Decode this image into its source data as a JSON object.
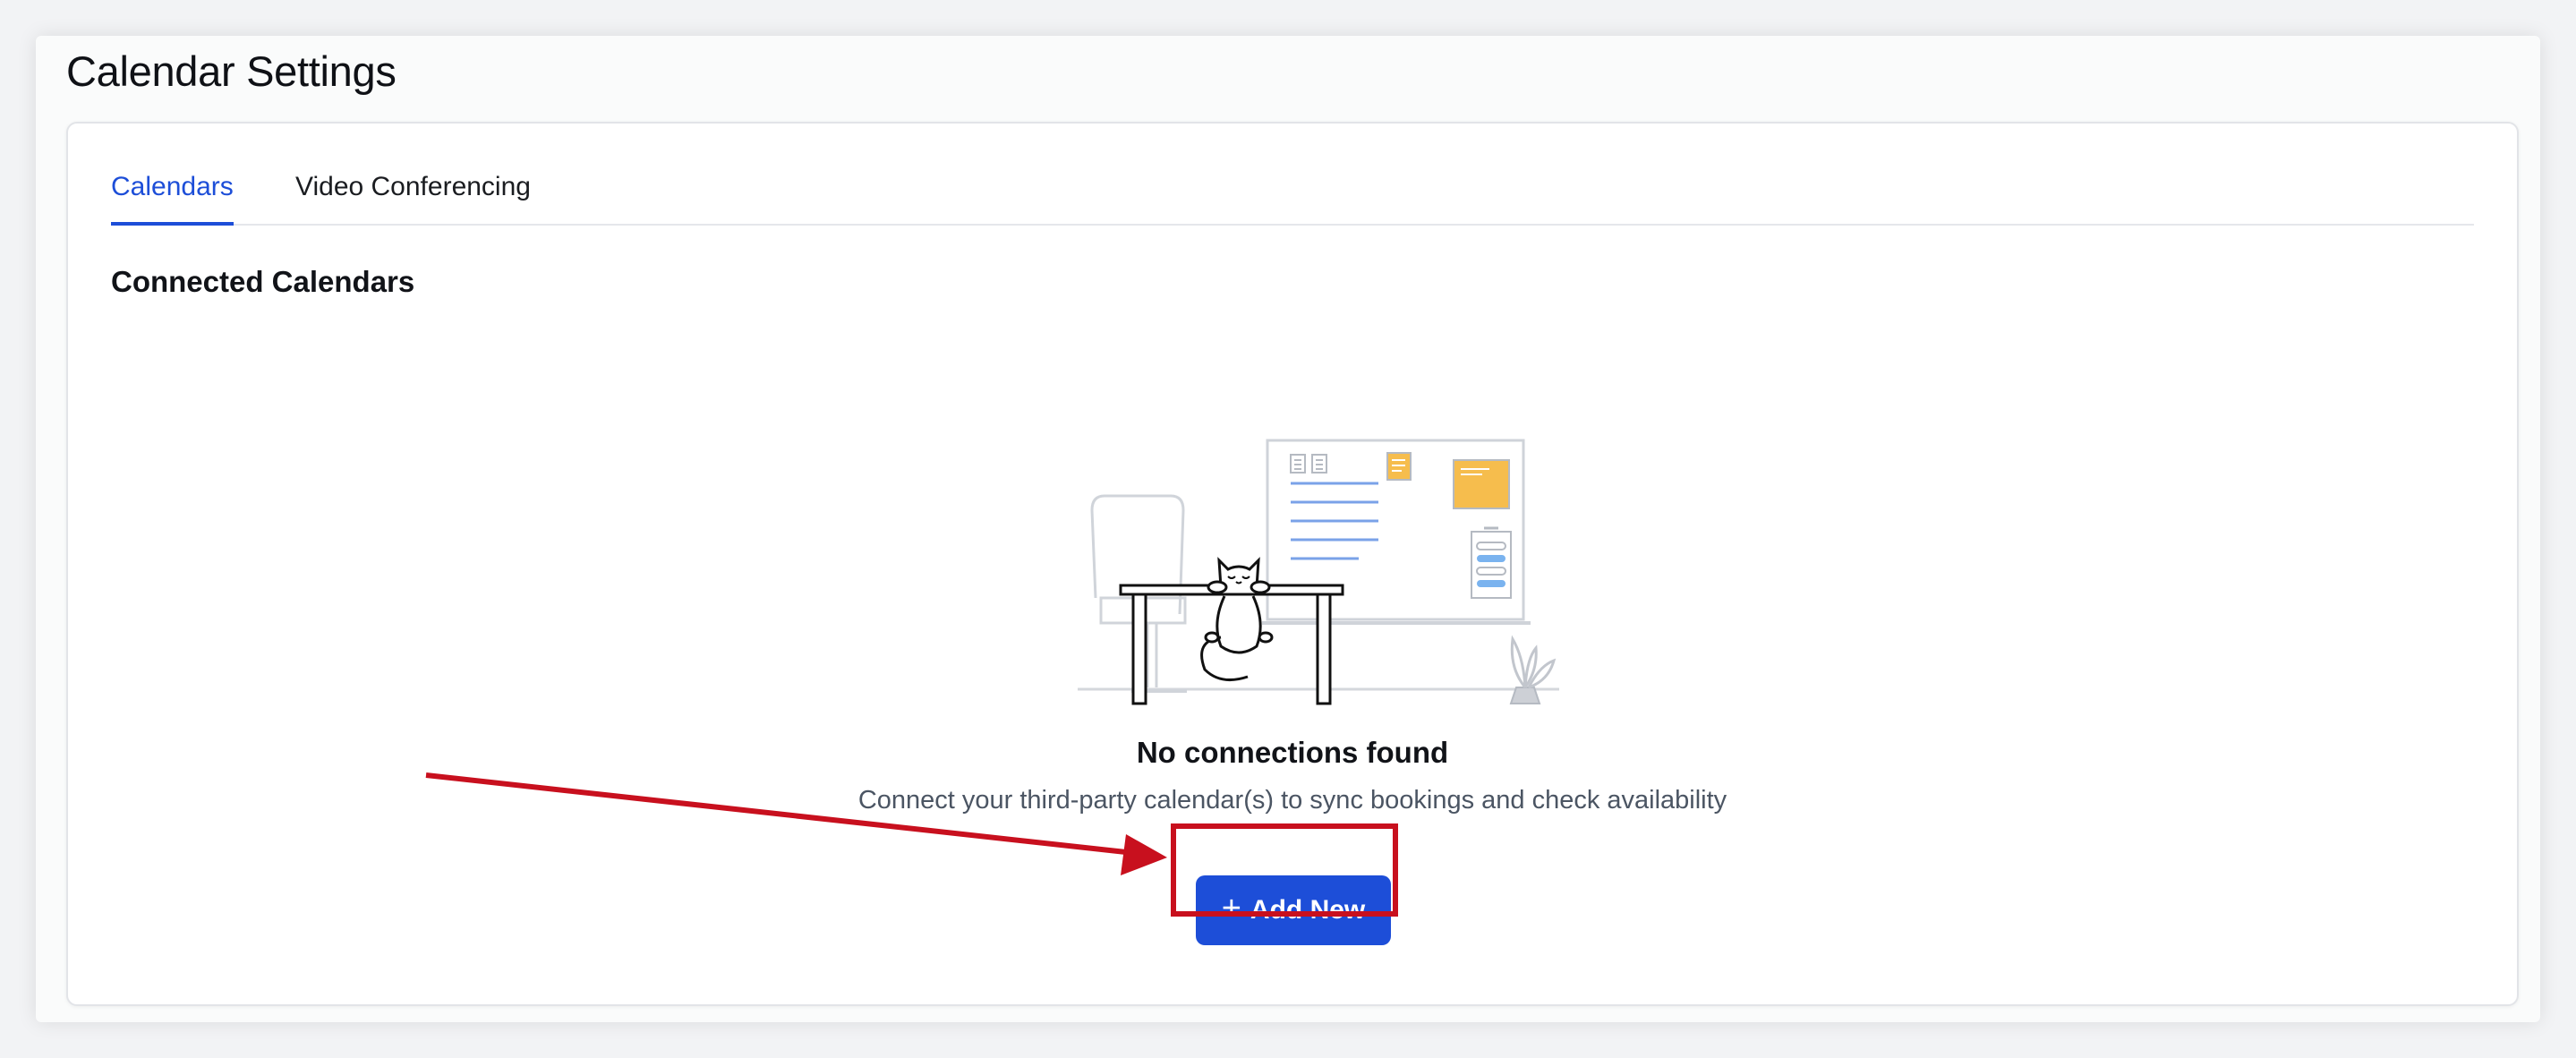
{
  "page": {
    "title": "Calendar Settings"
  },
  "tabs": [
    {
      "label": "Calendars",
      "active": true
    },
    {
      "label": "Video Conferencing",
      "active": false
    }
  ],
  "section": {
    "heading": "Connected Calendars"
  },
  "empty_state": {
    "illustration": "cat-at-desk-illustration",
    "title": "No connections found",
    "description": "Connect your third-party calendar(s) to sync bookings and check availability"
  },
  "actions": {
    "add_new_label": "Add New",
    "add_new_icon": "plus-icon"
  },
  "annotation": {
    "highlight_color": "#c8101e"
  },
  "colors": {
    "accent": "#1d4ed8",
    "text_primary": "#111318",
    "text_secondary": "#4b5563"
  }
}
